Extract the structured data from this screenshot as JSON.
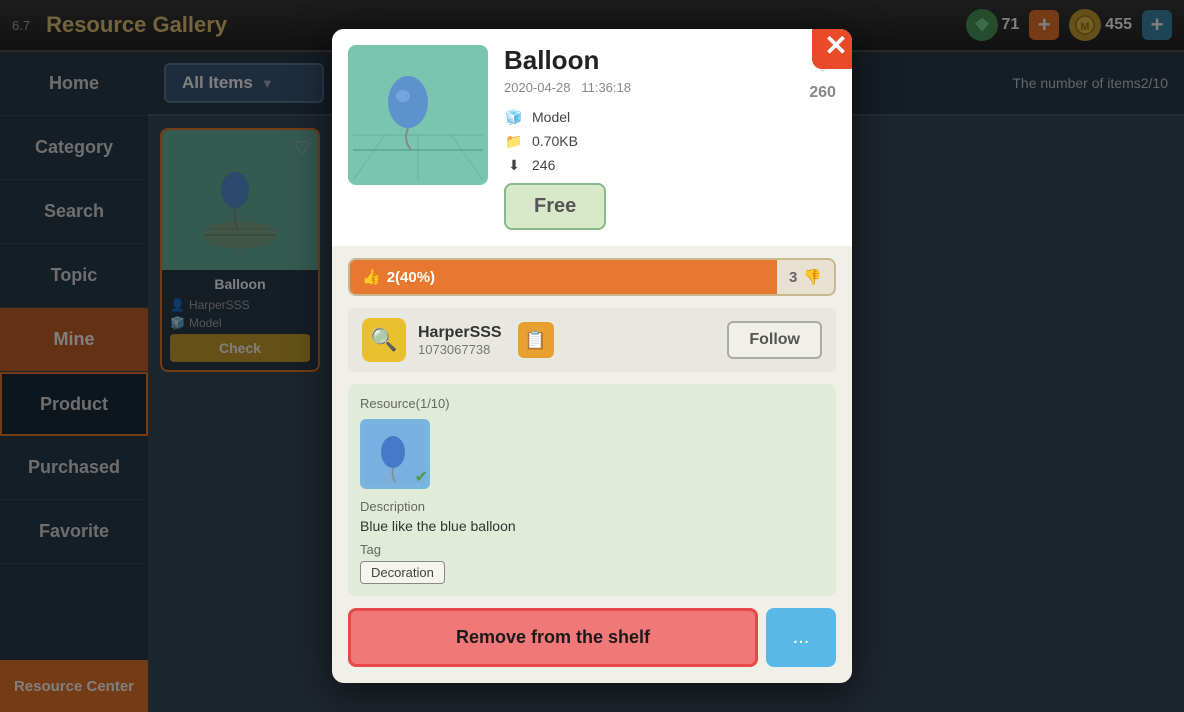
{
  "app": {
    "title": "Resource Gallery",
    "version": "6.7"
  },
  "topbar": {
    "gem_count": "71",
    "coin_count": "455",
    "plus_label": "+",
    "items_count_label": "The number of items2/10"
  },
  "sidebar": {
    "items": [
      {
        "label": "Home",
        "active": false
      },
      {
        "label": "Category",
        "active": false
      },
      {
        "label": "Search",
        "active": false
      },
      {
        "label": "Topic",
        "active": false
      },
      {
        "label": "Mine",
        "active": true
      }
    ],
    "sub_items": [
      {
        "label": "Product",
        "highlighted": true
      },
      {
        "label": "Purchased",
        "highlighted": false
      },
      {
        "label": "Favorite",
        "highlighted": false
      }
    ],
    "bottom_label": "Resource Center"
  },
  "main": {
    "header": {
      "dropdown_label": "All Items",
      "chevron": "▼",
      "items_count": "The number of items2/10"
    },
    "items": [
      {
        "name": "Balloon",
        "author": "HarperSSS",
        "type": "Model",
        "check_label": "Check"
      }
    ]
  },
  "modal": {
    "title": "Balloon",
    "date": "2020-04-28",
    "time": "11:36:18",
    "heart_count": "260",
    "type_label": "Model",
    "size_label": "0.70KB",
    "download_count": "246",
    "rating": {
      "upvote_label": "2(40%)",
      "downvote_count": "3"
    },
    "author": {
      "name": "HarperSSS",
      "id": "1073067738",
      "follow_label": "Follow"
    },
    "resource_label": "Resource(1/10)",
    "description_label": "Description",
    "description_text": "Blue like the blue balloon",
    "tag_label": "Tag",
    "tag": "Decoration",
    "remove_btn_label": "Remove from the shelf",
    "more_btn_label": "...",
    "free_btn_label": "Free",
    "close_label": "✕"
  }
}
